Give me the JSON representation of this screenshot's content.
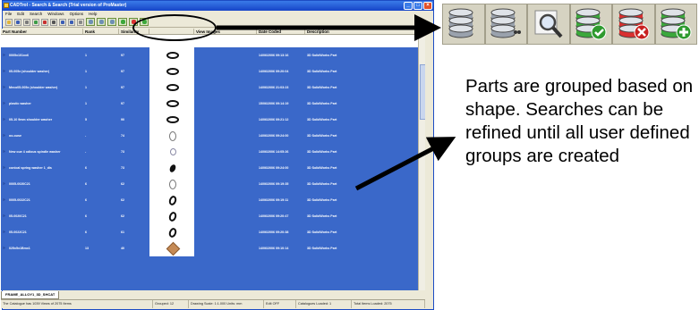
{
  "window": {
    "title": "CADTrol - Search & Search (Trial version of ProMaster)",
    "menu": [
      "File",
      "Edit",
      "Search",
      "Windows",
      "Options",
      "Help"
    ]
  },
  "grid": {
    "columns": [
      "Part Number",
      "Rank",
      "Similarity",
      "",
      "View Images",
      "Date Coded",
      "Description"
    ],
    "rows": [
      {
        "part": "0005x101xx6",
        "rank": "1",
        "sim": "97",
        "date": "14/06/2006 09:13:16",
        "desc": "3D SolidWorks Part",
        "shape": "ring"
      },
      {
        "part": "05-005x (shoulder washer)",
        "rank": "1",
        "sim": "97",
        "date": "14/06/2006 09:20:04",
        "desc": "3D SolidWorks Part",
        "shape": "ring"
      },
      {
        "part": "Meco05-005x (shoulder washer)",
        "rank": "1",
        "sim": "97",
        "date": "14/06/2006 21:03:23",
        "desc": "3D SolidWorks Part",
        "shape": "ring"
      },
      {
        "part": "plastic washer",
        "rank": "1",
        "sim": "97",
        "date": "15/06/2006 09:14:19",
        "desc": "3D SolidWorks Part",
        "shape": "ring"
      },
      {
        "part": "05-10 9mm shoulder washer",
        "rank": "5",
        "sim": "90",
        "date": "14/06/2006 09:21:12",
        "desc": "3D SolidWorks Part",
        "shape": "ring"
      },
      {
        "part": "oo-ouse",
        "rank": "-",
        "sim": "74",
        "date": "14/06/2006 09:24:00",
        "desc": "3D SolidWorks Part",
        "shape": "thin"
      },
      {
        "part": "New oue 4 odious spindle washer",
        "rank": "-",
        "sim": "73",
        "date": "14/06/2006 14:05:26",
        "desc": "3D SolidWorks Part",
        "shape": "grey"
      },
      {
        "part": "conical spring washer 1_dis",
        "rank": "6",
        "sim": "73",
        "date": "14/06/2006 09:24:00",
        "desc": "3D SolidWorks Part",
        "shape": "blob"
      },
      {
        "part": "0005-0020C21",
        "rank": "6",
        "sim": "62",
        "date": "14/06/2006 09:19:35",
        "desc": "3D SolidWorks Part",
        "shape": "thin"
      },
      {
        "part": "0005-0022C21",
        "rank": "6",
        "sim": "62",
        "date": "14/06/2006 09:19:11",
        "desc": "3D SolidWorks Part",
        "shape": "tilt"
      },
      {
        "part": "05-0020C21",
        "rank": "6",
        "sim": "62",
        "date": "14/06/2006 09:20:47",
        "desc": "3D SolidWorks Part",
        "shape": "tilt"
      },
      {
        "part": "05-0022C21",
        "rank": "6",
        "sim": "61",
        "date": "14/06/2006 09:20:38",
        "desc": "3D SolidWorks Part",
        "shape": "tilt"
      },
      {
        "part": "025x5x1Bmx1",
        "rank": "13",
        "sim": "40",
        "date": "14/06/2006 09:10:14",
        "desc": "3D SolidWorks Part",
        "shape": "diamond"
      }
    ]
  },
  "tab": {
    "label": "FRAME_ALLOY1_3D_SHCAT"
  },
  "status": [
    "The Catalogue has 1039 Views of 2075 Items",
    "Grouped: 12",
    "Drawing Scale: 1:1.000 Units: mm",
    "Edit OFF",
    "Catalogues Loaded: 1",
    "Total Items Loaded: 2075"
  ],
  "callout": {
    "icons": [
      {
        "name": "database-search-icon",
        "badge": "none",
        "color": "#9aa2ad"
      },
      {
        "name": "database-refine-icon",
        "badge": "dots",
        "color": "#9aa2ad"
      },
      {
        "name": "magnifier-icon",
        "badge": "lens",
        "color": "#9aa2ad"
      },
      {
        "name": "database-check-icon",
        "badge": "check",
        "color": "#3ca83c"
      },
      {
        "name": "database-delete-icon",
        "badge": "x",
        "color": "#d93030"
      },
      {
        "name": "database-add-icon",
        "badge": "plus",
        "color": "#3ca83c"
      }
    ],
    "caption": "Parts are grouped based on shape. Searches can be refined until all user defined groups are created"
  }
}
